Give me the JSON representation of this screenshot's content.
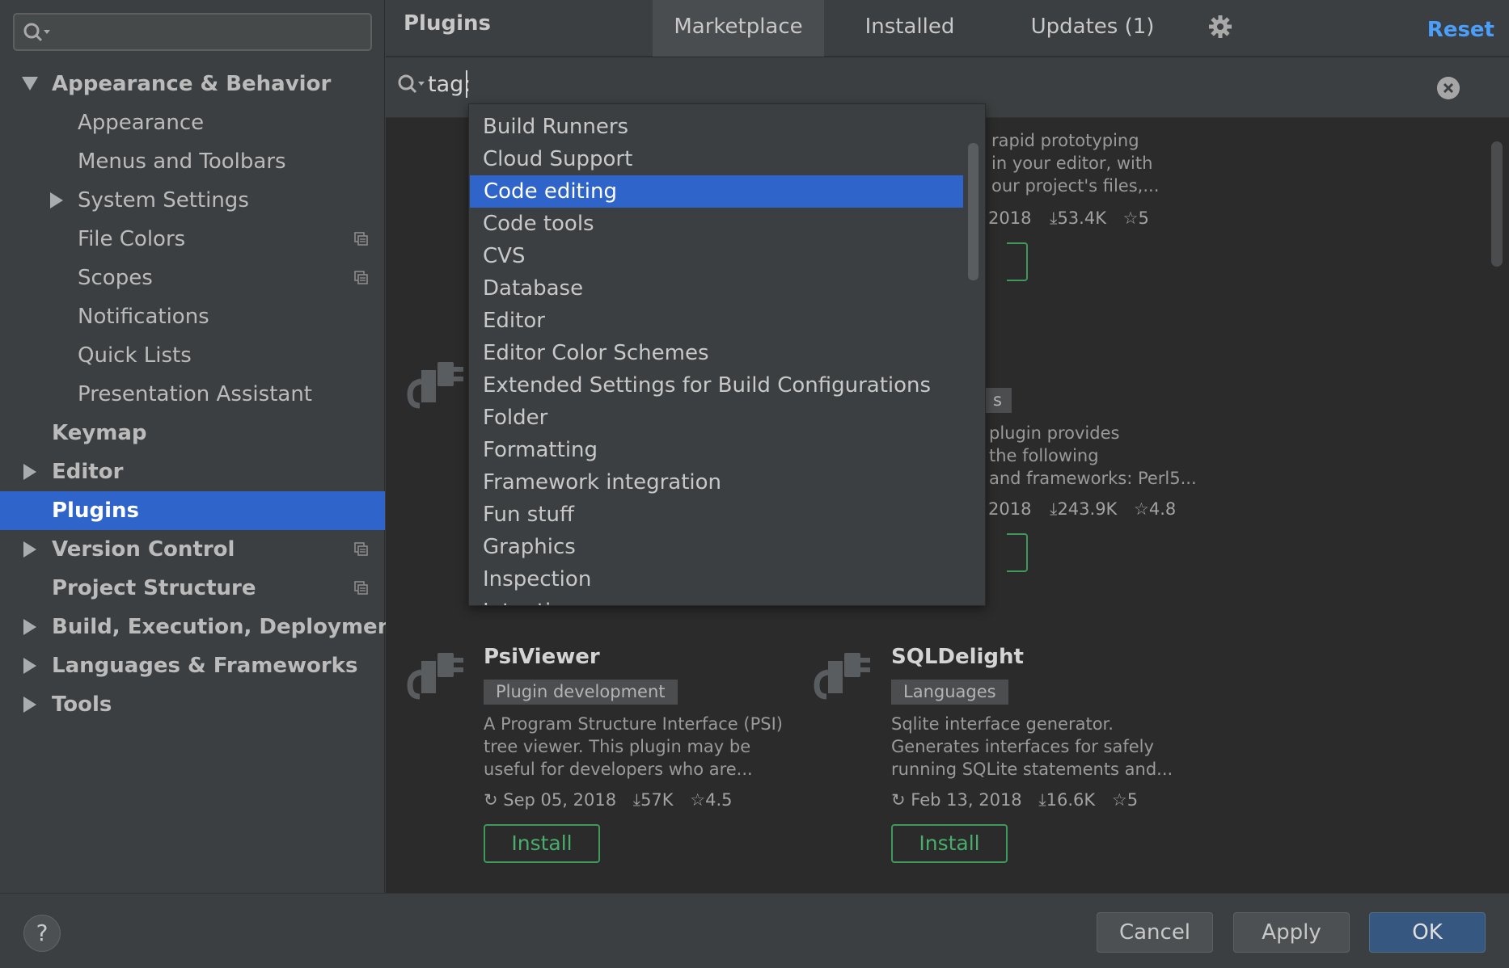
{
  "sidebar": {
    "search_placeholder": "",
    "items": [
      {
        "label": "Appearance & Behavior",
        "bold": true,
        "arrow": "down"
      },
      {
        "label": "Appearance"
      },
      {
        "label": "Menus and Toolbars"
      },
      {
        "label": "System Settings",
        "arrow": "right"
      },
      {
        "label": "File Colors",
        "copy_icon": true
      },
      {
        "label": "Scopes",
        "copy_icon": true
      },
      {
        "label": "Notifications"
      },
      {
        "label": "Quick Lists"
      },
      {
        "label": "Presentation Assistant"
      },
      {
        "label": "Keymap",
        "bold": true
      },
      {
        "label": "Editor",
        "bold": true,
        "arrow": "right"
      },
      {
        "label": "Plugins",
        "bold": true,
        "selected": true
      },
      {
        "label": "Version Control",
        "bold": true,
        "arrow": "right",
        "copy_icon": true
      },
      {
        "label": "Project Structure",
        "bold": true,
        "copy_icon": true
      },
      {
        "label": "Build, Execution, Deployment",
        "bold": true,
        "arrow": "right"
      },
      {
        "label": "Languages & Frameworks",
        "bold": true,
        "arrow": "right"
      },
      {
        "label": "Tools",
        "bold": true,
        "arrow": "right"
      }
    ]
  },
  "header": {
    "title": "Plugins",
    "tabs": [
      "Marketplace",
      "Installed",
      "Updates (1)"
    ],
    "active_tab": "Marketplace",
    "reset_label": "Reset"
  },
  "search": {
    "value": "tag:"
  },
  "dropdown": {
    "items": [
      "Build Runners",
      "Cloud Support",
      "Code editing",
      "Code tools",
      "CVS",
      "Database",
      "Editor",
      "Editor Color Schemes",
      "Extended Settings for Build Configurations",
      "Folder",
      "Formatting",
      "Framework integration",
      "Fun stuff",
      "Graphics",
      "Inspection",
      "Intention"
    ],
    "selected": "Code editing"
  },
  "partial_cards": {
    "card1": {
      "desc_lines": [
        "rapid prototyping",
        "in your editor, with",
        "our project's files,..."
      ],
      "date": "2018",
      "downloads": "53.4K",
      "rating": "5"
    },
    "card2": {
      "tag_fragment": "s",
      "desc_lines": [
        "plugin provides",
        "the following",
        "and frameworks: Perl5..."
      ],
      "date": "2018",
      "downloads": "243.9K",
      "rating": "4.8"
    }
  },
  "plugins": [
    {
      "name": "PsiViewer",
      "tag": "Plugin development",
      "description": "A Program Structure Interface (PSI) tree viewer. This plugin may be useful for developers who are...",
      "date": "Sep 05, 2018",
      "downloads": "57K",
      "rating": "4.5",
      "install_label": "Install"
    },
    {
      "name": "SQLDelight",
      "tag": "Languages",
      "description": "Sqlite interface generator. Generates interfaces for safely running SQLite statements and...",
      "date": "Feb 13, 2018",
      "downloads": "16.6K",
      "rating": "5",
      "install_label": "Install"
    }
  ],
  "footer": {
    "help_label": "?",
    "cancel_label": "Cancel",
    "apply_label": "Apply",
    "ok_label": "OK"
  },
  "colors": {
    "selection": "#2f65ca",
    "install_green": "#4bad6b",
    "link_blue": "#4b9ffb"
  }
}
